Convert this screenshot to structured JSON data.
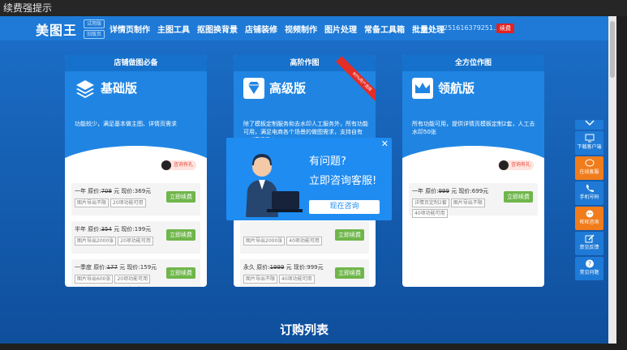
{
  "window_title": "续费强提示",
  "nav": {
    "logo": "美图王",
    "tags": [
      "试用版",
      "旧版页"
    ],
    "menu": [
      "详情页制作",
      "主图工具",
      "抠图换背景",
      "店铺装修",
      "视频制作",
      "图片处理",
      "常备工具箱",
      "批量处理"
    ],
    "user_id": "251616379251...",
    "renew_label": "续费"
  },
  "cards": [
    {
      "header": "店铺做图必备",
      "title": "基础版",
      "desc": "功能较少，满足基本做主图、详情页需求",
      "qq": "咨询有礼",
      "plans": [
        {
          "prefix": "一年 原价:",
          "orig": "708",
          "mid": " 元 现价:",
          "now": "369元",
          "chips": [
            "图片导出不限",
            "20项功能可用"
          ],
          "btn": "立即续费"
        },
        {
          "prefix": "半年 原价:",
          "orig": "354",
          "mid": " 元 现价:",
          "now": "199元",
          "chips": [
            "图片导出2000张",
            "20项功能可用"
          ],
          "btn": "立即续费"
        },
        {
          "prefix": "一季度 原价:",
          "orig": "177",
          "mid": " 元 现价:",
          "now": "159元",
          "chips": [
            "图片导出600张",
            "20项功能可用"
          ],
          "btn": "立即续费"
        }
      ]
    },
    {
      "header": "高阶作图",
      "title": "高级版",
      "ribbon": "90%用户选择",
      "desc": "除了模板定制服务和去水印人工服务外，所有功能可用，满足电商各个场景的做图需求，支持自有psd模板导入",
      "qq": "咨询有礼",
      "plans": [
        {
          "prefix": "",
          "orig": "",
          "mid": "",
          "now": "",
          "chips": [
            "图片导出2000张",
            "40项功能可用"
          ],
          "btn": "立即续费"
        },
        {
          "prefix": "永久 原价:",
          "orig": "1999",
          "mid": " 元 现价:",
          "now": "999元",
          "chips": [
            "图片导出不限",
            "40项功能可用"
          ],
          "btn": "立即续费"
        }
      ]
    },
    {
      "header": "全方位作图",
      "title": "领航版",
      "desc": "所有功能可用，提供详情页模板定制2套，人工去水印50张",
      "qq": "咨询有礼",
      "plans": [
        {
          "prefix": "一年 原价:",
          "orig": "999",
          "mid": " 元 现价:",
          "now": "699元",
          "chips": [
            "详情页定制2套",
            "图片导出不限",
            "40项功能可用"
          ],
          "btn": "立即续费"
        }
      ]
    }
  ],
  "popup": {
    "title": "有问题?",
    "subtitle": "立即咨询客服!",
    "button": "现在咨询",
    "close": "✕"
  },
  "section_title": "订购列表",
  "sidebar": [
    {
      "label": "下载客户端",
      "icon": "desktop-icon",
      "color": "#1e7ad6"
    },
    {
      "label": "在线客服",
      "icon": "chat-icon",
      "color": "#f07c1c"
    },
    {
      "label": "手机号码",
      "icon": "phone-icon",
      "color": "#1e7ad6"
    },
    {
      "label": "旺旺咨询",
      "icon": "wangwang-icon",
      "color": "#f07c1c"
    },
    {
      "label": "意见反馈",
      "icon": "edit-icon",
      "color": "#1e7ad6"
    },
    {
      "label": "常见问题",
      "icon": "question-icon",
      "color": "#1e7ad6"
    }
  ],
  "colors": {
    "nav": "#1e7ad6",
    "card_top": "#2085e2",
    "renew_btn": "#6fb64a",
    "accent_red": "#e52121",
    "sidebar_orange": "#f07c1c",
    "popup": "#1f8cf2"
  }
}
